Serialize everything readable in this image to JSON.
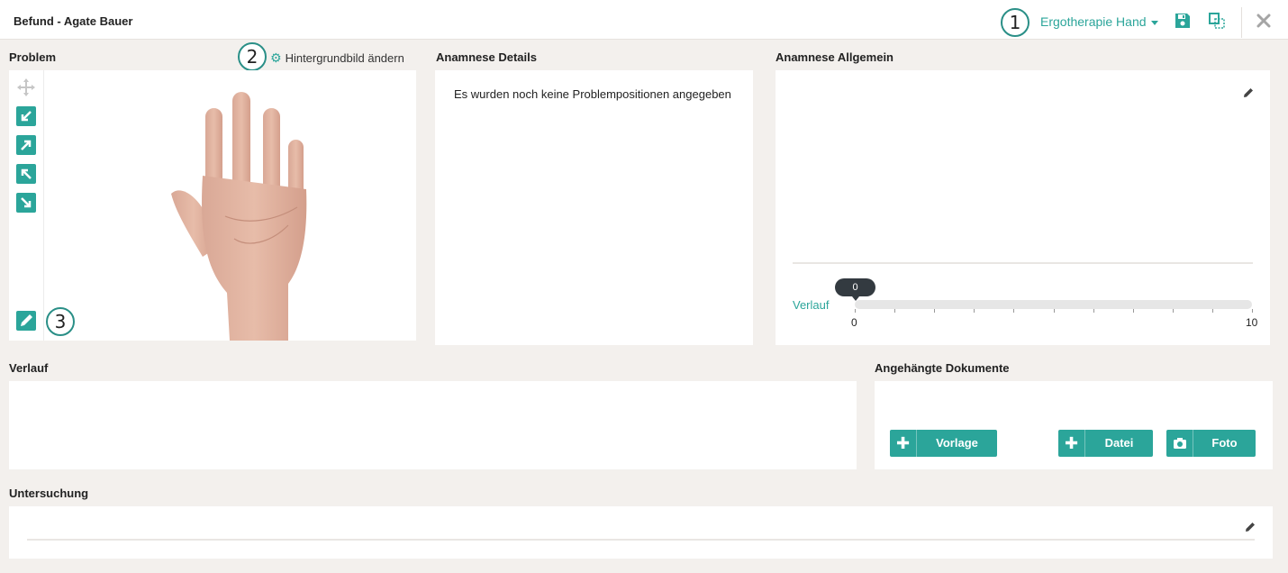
{
  "header": {
    "title": "Befund - Agate Bauer",
    "mode_select": "Ergotherapie Hand"
  },
  "callouts": [
    "1",
    "2",
    "3"
  ],
  "problem": {
    "label": "Problem",
    "background_link": "Hintergrundbild ändern",
    "tools": [
      "move-icon",
      "arrow-down-left-icon",
      "arrow-up-right-icon",
      "arrow-up-left-icon",
      "arrow-down-right-icon",
      "pen-icon"
    ]
  },
  "anamnese_details": {
    "label": "Anamnese Details",
    "empty_text": "Es wurden noch keine Problempositionen angegeben"
  },
  "anamnese_allgemein": {
    "label": "Anamnese Allgemein",
    "slider": {
      "label": "Verlauf",
      "value": "0",
      "min": "0",
      "max": "10"
    }
  },
  "verlauf": {
    "label": "Verlauf"
  },
  "dokumente": {
    "label": "Angehängte Dokumente",
    "buttons": {
      "vorlage": "Vorlage",
      "datei": "Datei",
      "foto": "Foto"
    }
  },
  "untersuchung": {
    "label": "Untersuchung"
  },
  "colors": {
    "accent": "#2ba59a",
    "background": "#f3f0ed"
  }
}
